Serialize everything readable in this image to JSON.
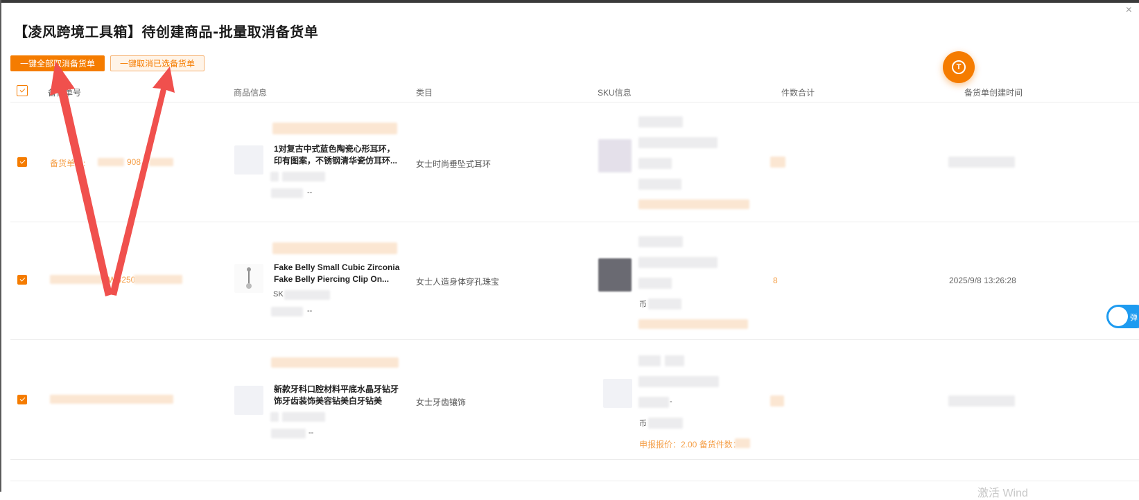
{
  "dialog": {
    "title": "【凌风跨境工具箱】待创建商品-批量取消备货单",
    "close_icon": "×"
  },
  "toolbar": {
    "cancel_all_label": "一键全部取消备货单",
    "cancel_selected_label": "一键取消已选备货单"
  },
  "fab": {
    "icon_label": "T"
  },
  "table": {
    "headers": [
      "备货单号",
      "商品信息",
      "类目",
      "SKU信息",
      "件数合计",
      "备货单创建时间"
    ],
    "rows": [
      {
        "order_prefix": "备货单号:",
        "order_suffix": "908",
        "product_name": "1对复古中式蓝色陶瓷心形耳环，印有图案，不锈钢清华瓷仿耳环...",
        "product_meta": "--",
        "category": "女士时尚垂坠式耳环",
        "qty": "",
        "created": ""
      },
      {
        "order_prefix": "",
        "order_suffix": "WB250",
        "product_name": "Fake Belly Small Cubic Zirconia Fake Belly Piercing Clip On...",
        "product_sku_prefix": "SK",
        "product_meta": "--",
        "category": "女士人造身体穿孔珠宝",
        "sku_currency": "币",
        "qty": "8",
        "created": "2025/9/8 13:26:28"
      },
      {
        "order_prefix": "",
        "order_suffix": "",
        "product_name": "新款牙科口腔材料平底水晶牙钻牙饰牙齿装饰美容钻美白牙钻美",
        "product_meta": "--",
        "category": "女士牙齿镶饰",
        "sku_dash": "-",
        "sku_currency": "币",
        "declare": "申报报价：2.00 备货件数：",
        "qty": "",
        "created": ""
      }
    ]
  },
  "toggle": {
    "label": "弹"
  },
  "watermark": {
    "text": "激活 Wind"
  },
  "colors": {
    "accent": "#f57c00",
    "toggle": "#1e9bf0",
    "arrow": "#f0504d"
  }
}
